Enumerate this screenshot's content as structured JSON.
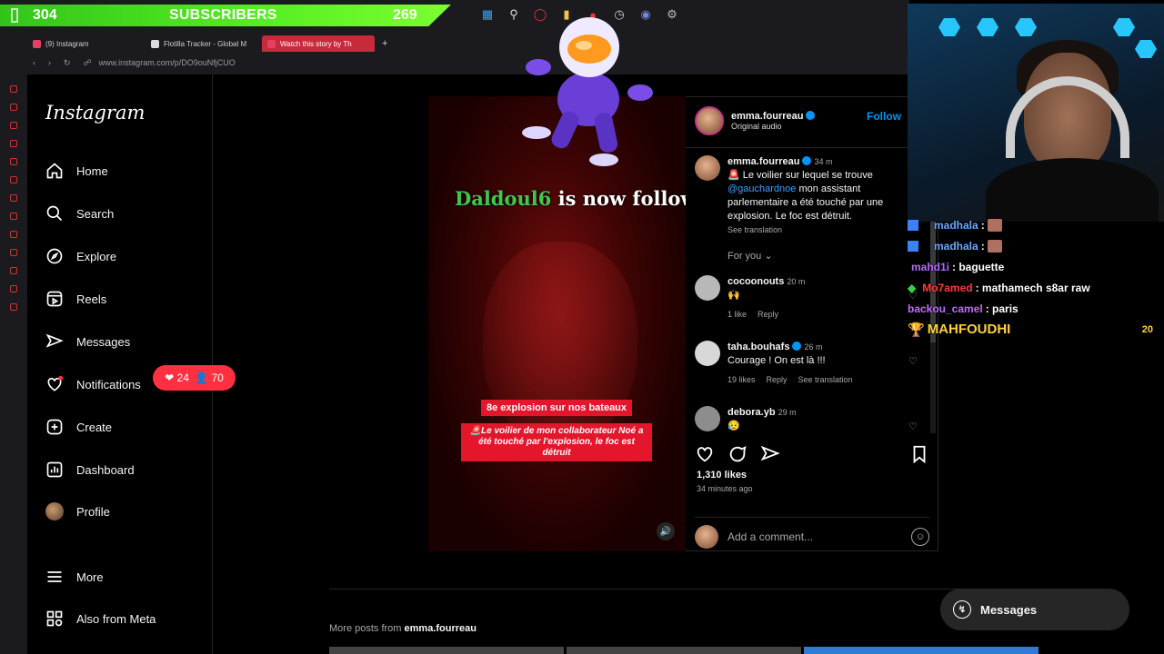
{
  "overlay": {
    "subscribers_left": "304",
    "subscribers_label": "SUBSCRIBERS",
    "subscribers_right": "269",
    "follow_alert_name": "Daldoul6",
    "follow_alert_text": " is now following!"
  },
  "browser": {
    "tabs": [
      {
        "label": "(9) Instagram",
        "icon": "instagram-icon"
      },
      {
        "label": "Flotilla Tracker - Global M",
        "icon": "page-icon"
      },
      {
        "label": "Watch this story by Th",
        "icon": "instagram-icon",
        "active": true
      }
    ],
    "new_tab": "+",
    "url": "www.instagram.com/p/DO9ouNfjCUO"
  },
  "sidebar": {
    "logo": "Instagram",
    "items": [
      {
        "label": "Home",
        "icon": "home-icon"
      },
      {
        "label": "Search",
        "icon": "search-icon"
      },
      {
        "label": "Explore",
        "icon": "compass-icon"
      },
      {
        "label": "Reels",
        "icon": "reels-icon"
      },
      {
        "label": "Messages",
        "icon": "send-icon"
      },
      {
        "label": "Notifications",
        "icon": "heart-icon"
      },
      {
        "label": "Create",
        "icon": "plus-square-icon"
      },
      {
        "label": "Dashboard",
        "icon": "chart-icon"
      },
      {
        "label": "Profile",
        "icon": "avatar"
      }
    ],
    "more": "More",
    "also_from_meta": "Also from Meta",
    "notif_likes": "24",
    "notif_follows": "70"
  },
  "post": {
    "media_title": "8e explosion sur nos bateaux",
    "media_caption": "🚨Le voilier de mon collaborateur Noé a été touché par l'explosion, le foc est détruit",
    "author": "emma.fourreau",
    "audio": "Original audio",
    "follow": "Follow",
    "caption_time": "34 m",
    "caption_pre": "🚨 Le voilier sur lequel se trouve ",
    "caption_mention": "@gauchardnoe",
    "caption_post": " mon assistant parlementaire a été touché par une explosion. Le foc est détruit.",
    "see_translation": "See translation",
    "for_you": "For you",
    "comments": [
      {
        "user": "cocoonouts",
        "time": "20 m",
        "text": "🙌",
        "likes": "1 like",
        "reply": "Reply"
      },
      {
        "user": "taha.bouhafs",
        "time": "26 m",
        "text": "Courage ! On est là !!!",
        "likes": "19 likes",
        "reply": "Reply",
        "translation": "See translation"
      },
      {
        "user": "debora.yb",
        "time": "29 m",
        "text": "😥"
      }
    ],
    "likes": "1,310 likes",
    "ago": "34 minutes ago",
    "add_comment_placeholder": "Add a comment..."
  },
  "below": {
    "more_posts_prefix": "More posts from ",
    "more_posts_user": "emma.fourreau",
    "messages_pill": "Messages"
  },
  "chat": [
    {
      "user": "madhala",
      "text": " : ",
      "color": "#6aa8ff"
    },
    {
      "user": "madhala",
      "text": " : ",
      "color": "#6aa8ff"
    },
    {
      "user": "mahd1i",
      "text": " : baguette",
      "color": "#b36bff"
    },
    {
      "user": "Mo7amed",
      "text": " : mathamech s8ar raw",
      "color": "#ff3b3b"
    },
    {
      "user": "backou_camel",
      "text": " : paris",
      "color": "#c06bff"
    },
    {
      "user": "MAHFOUDHI",
      "text": "",
      "color": "#ffd23a"
    }
  ],
  "chat_top_count": "20"
}
